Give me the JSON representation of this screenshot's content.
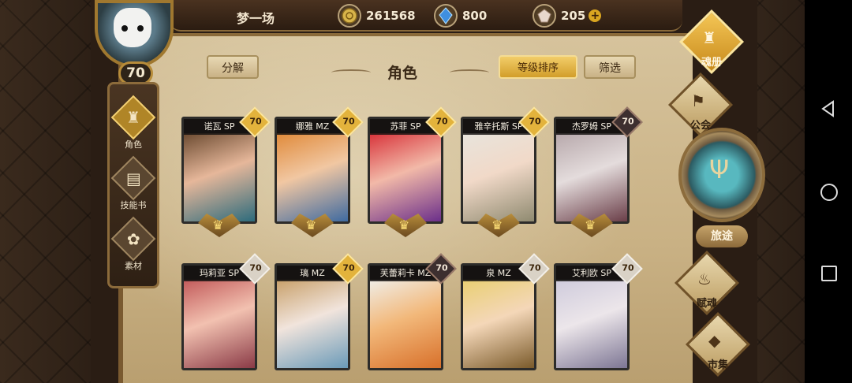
{
  "player": {
    "name": "梦一场",
    "level": "70"
  },
  "resources": [
    {
      "icon": "gold-coin-icon",
      "value": "261568"
    },
    {
      "icon": "blue-crystal-icon",
      "value": "800"
    },
    {
      "icon": "gem-icon",
      "value": "205"
    }
  ],
  "header": {
    "title": "角色",
    "decompose": "分解",
    "sort": "等级排序",
    "filter": "筛选"
  },
  "side_menu": [
    {
      "label": "角色",
      "icon": "character-icon"
    },
    {
      "label": "技能书",
      "icon": "skill-book-icon"
    },
    {
      "label": "素材",
      "icon": "material-icon"
    }
  ],
  "right_menu": {
    "soul": "魂册",
    "guild": "公会",
    "journey": "旅途",
    "fate": "赋魂",
    "market": "市集"
  },
  "cards": [
    {
      "name": "诺瓦 SP",
      "level": "70"
    },
    {
      "name": "娜雅 MZ",
      "level": "70"
    },
    {
      "name": "苏菲 SP",
      "level": "70"
    },
    {
      "name": "雅辛托斯 SP",
      "level": "70"
    },
    {
      "name": "杰罗姆 SP",
      "level": "70"
    },
    {
      "name": "玛莉亚 SP",
      "level": "70"
    },
    {
      "name": "璃 MZ",
      "level": "70"
    },
    {
      "name": "芙蕾莉卡 MZ",
      "level": "70"
    },
    {
      "name": "泉 MZ",
      "level": "70"
    },
    {
      "name": "艾利欧 SP",
      "level": "70"
    }
  ]
}
